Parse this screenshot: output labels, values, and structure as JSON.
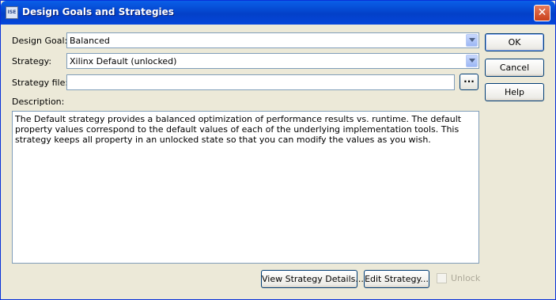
{
  "window": {
    "title": "Design Goals and Strategies",
    "icon": "xilinx-app-icon",
    "close": "✕"
  },
  "form": {
    "design_goal": {
      "label": "Design Goal:",
      "value": "Balanced"
    },
    "strategy": {
      "label": "Strategy:",
      "value": "Xilinx Default (unlocked)"
    },
    "strategy_file": {
      "label": "Strategy file:",
      "value": "",
      "browse_label": "..."
    },
    "description": {
      "label": "Description:",
      "text": "The Default strategy provides a balanced optimization of performance results vs. runtime. The default property values correspond to the default values of each of the underlying implementation tools. This strategy keeps all property in an unlocked state so that you can modify the values as you wish."
    }
  },
  "buttons": {
    "ok": "OK",
    "cancel": "Cancel",
    "help": "Help",
    "view_details": "View Strategy Details...",
    "edit_strategy": "Edit Strategy...",
    "unlock": "Unlock"
  },
  "state": {
    "unlock_checked": false,
    "unlock_enabled": false
  }
}
